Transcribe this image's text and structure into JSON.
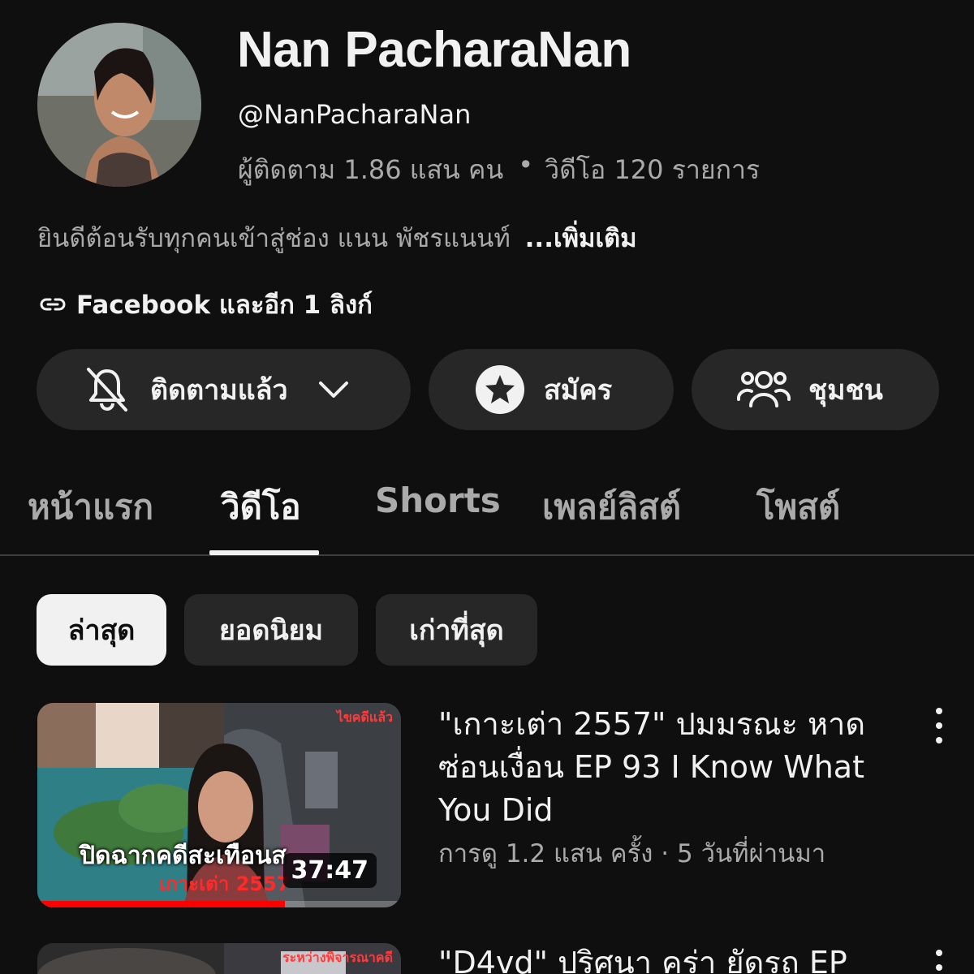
{
  "channel": {
    "name": "Nan PacharaNan",
    "handle": "@NanPacharaNan",
    "subscribers": "ผู้ติดตาม 1.86 แสน คน",
    "separator": "•",
    "video_count": "วิดีโอ 120 รายการ",
    "description": "ยินดีต้อนรับทุกคนเข้าสู่ช่อง แนน พัชรแนนท์",
    "more_label": "...เพิ่มเติม",
    "links_label": "Facebook และอีก 1 ลิงก์"
  },
  "actions": {
    "subscribed_label": "ติดตามแล้ว",
    "join_label": "สมัคร",
    "community_label": "ชุมชน"
  },
  "tabs": [
    {
      "label": "หน้าแรก",
      "active": false
    },
    {
      "label": "วิดีโอ",
      "active": true
    },
    {
      "label": "Shorts",
      "active": false
    },
    {
      "label": "เพลย์ลิสต์",
      "active": false
    },
    {
      "label": "โพสต์",
      "active": false
    }
  ],
  "filters": [
    {
      "label": "ล่าสุด",
      "active": true
    },
    {
      "label": "ยอดนิยม",
      "active": false
    },
    {
      "label": "เก่าที่สุด",
      "active": false
    }
  ],
  "videos": [
    {
      "title": "\"เกาะเต่า 2557\" ปมมรณะ หาดซ่อนเงื่อน EP 93 I Know What You Did",
      "meta": "การดู 1.2 แสน ครั้ง · 5 วันที่ผ่านมา",
      "duration": "37:47",
      "thumb_text": "ปิดฉากคดีสะเทือนส",
      "thumb_subtext": "เกาะเต่า 2557",
      "thumb_corner": "ไขคดีแล้ว",
      "watched_fraction": 0.68
    },
    {
      "title": "\"D4vd\" ปริศนา คร่า ยัดรถ EP",
      "thumb_corner": "ระหว่างพิจารณาคดี"
    }
  ],
  "colors": {
    "background": "#0f0f0f",
    "surface": "#272727",
    "text_primary": "#f1f1f1",
    "text_secondary": "#aaaaaa",
    "progress": "#ff0000"
  }
}
